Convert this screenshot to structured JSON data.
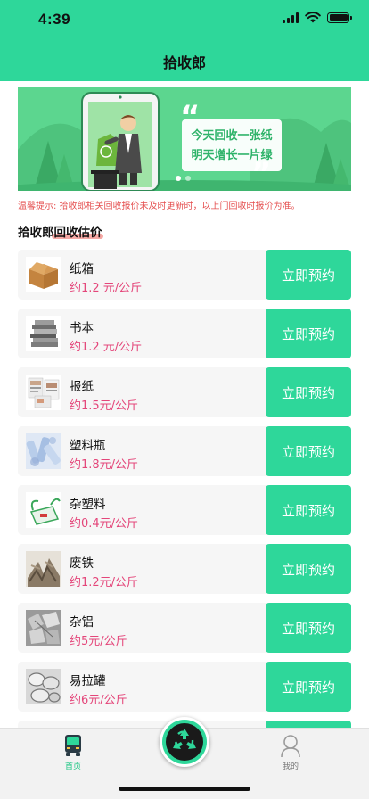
{
  "status_bar": {
    "time": "4:39"
  },
  "nav": {
    "title": "拾收郎"
  },
  "banner": {
    "line1": "今天回收一张纸",
    "line2": "明天增长一片绿"
  },
  "notice": "温馨提示: 拾收郎相关回收报价未及时更新时，以上门回收时报价为准。",
  "section_title": "拾收郎回收估价",
  "items": [
    {
      "name": "纸箱",
      "price": "约1.2 元/公斤",
      "button": "立即预约",
      "thumb": "cardboard-box"
    },
    {
      "name": "书本",
      "price": "约1.2 元/公斤",
      "button": "立即预约",
      "thumb": "books"
    },
    {
      "name": "报纸",
      "price": "约1.5元/公斤",
      "button": "立即预约",
      "thumb": "newspaper"
    },
    {
      "name": "塑料瓶",
      "price": "约1.8元/公斤",
      "button": "立即预约",
      "thumb": "plastic-bottles"
    },
    {
      "name": "杂塑料",
      "price": "约0.4元/公斤",
      "button": "立即预约",
      "thumb": "plastic-bag"
    },
    {
      "name": "废铁",
      "price": "约1.2元/公斤",
      "button": "立即预约",
      "thumb": "scrap-iron"
    },
    {
      "name": "杂铝",
      "price": "约5元/公斤",
      "button": "立即预约",
      "thumb": "aluminum-scrap"
    },
    {
      "name": "易拉罐",
      "price": "约6元/公斤",
      "button": "立即预约",
      "thumb": "cans"
    }
  ],
  "tab_bar": {
    "home": {
      "label": "首页",
      "icon": "truck-icon"
    },
    "center": {
      "icon": "recycle-icon"
    },
    "mine": {
      "label": "我的",
      "icon": "user-icon"
    }
  },
  "colors": {
    "brand": "#2ed79a",
    "price": "#e4467a",
    "notice": "#e55050"
  }
}
